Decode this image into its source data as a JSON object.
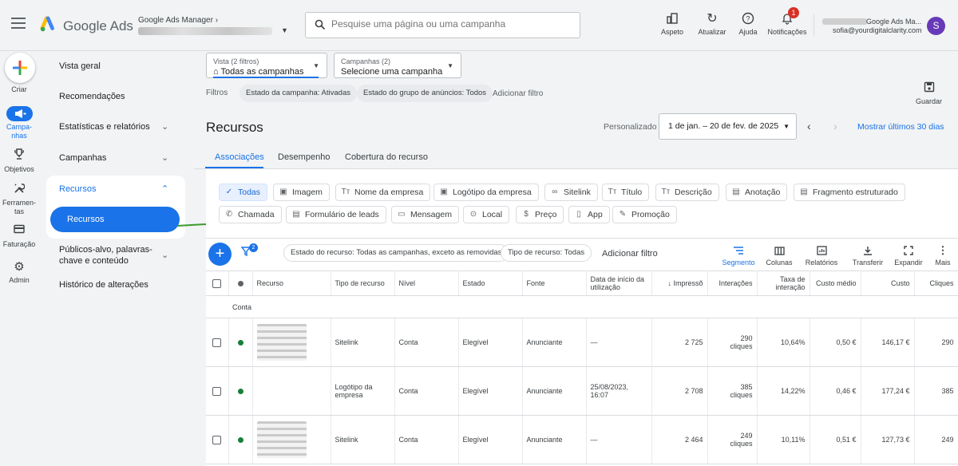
{
  "topbar": {
    "brand": "Google Ads",
    "manager_label": "Google Ads Manager",
    "search_placeholder": "Pesquise uma página ou uma campanha",
    "buttons": {
      "appearance": "Aspeto",
      "refresh": "Atualizar",
      "help": "Ajuda",
      "notifications": "Notificações"
    },
    "notification_count": "1",
    "account_name": "Google Ads Ma...",
    "account_email": "sofia@yourdigitalclarity.com",
    "avatar_letter": "S"
  },
  "rail": {
    "create": "Criar",
    "campaigns": "Campa-\nnhas",
    "goals": "Objetivos",
    "tools": "Ferramen-\ntas",
    "billing": "Faturação",
    "admin": "Admin"
  },
  "nav": {
    "overview": "Vista geral",
    "recommendations": "Recomendações",
    "stats": "Estatísticas e relatórios",
    "campaigns": "Campanhas",
    "assets_group": "Recursos",
    "assets_selected": "Recursos",
    "audiences": "Públicos-alvo, palavras-\nchave e conteúdo",
    "history": "Histórico de alterações"
  },
  "view_select": {
    "label": "Vista (2 filtros)",
    "value": "Todas as campanhas"
  },
  "campaign_select": {
    "label": "Campanhas (2)",
    "value": "Selecione uma campanha"
  },
  "filters": {
    "label": "Filtros",
    "chips": [
      "Estado da campanha: Ativadas",
      "Estado do grupo de anúncios: Todos"
    ],
    "add": "Adicionar filtro"
  },
  "save_label": "Guardar",
  "page_title": "Recursos",
  "date": {
    "label": "Personalizado",
    "range": "1 de jan. – 20 de fev. de 2025",
    "show_last": "Mostrar últimos 30 dias"
  },
  "tabs": [
    "Associações",
    "Desempenho",
    "Cobertura do recurso"
  ],
  "asset_types": {
    "row1": [
      {
        "label": "Todas",
        "icon": "check"
      },
      {
        "label": "Imagem",
        "icon": "image"
      },
      {
        "label": "Nome da empresa",
        "icon": "text"
      },
      {
        "label": "Logótipo da empresa",
        "icon": "image"
      },
      {
        "label": "Sitelink",
        "icon": "link"
      },
      {
        "label": "Título",
        "icon": "text"
      },
      {
        "label": "Descrição",
        "icon": "text"
      },
      {
        "label": "Anotação",
        "icon": "doc"
      },
      {
        "label": "Fragmento estruturado",
        "icon": "doc"
      }
    ],
    "row2": [
      {
        "label": "Chamada",
        "icon": "phone"
      },
      {
        "label": "Formulário de leads",
        "icon": "form"
      },
      {
        "label": "Mensagem",
        "icon": "message"
      },
      {
        "label": "Local",
        "icon": "pin"
      },
      {
        "label": "Preço",
        "icon": "price"
      },
      {
        "label": "App",
        "icon": "app"
      },
      {
        "label": "Promoção",
        "icon": "promo"
      }
    ]
  },
  "table_toolbar": {
    "filter_count": "2",
    "chips": [
      "Estado do recurso: Todas as campanhas, exceto as removidas",
      "Tipo de recurso: Todas"
    ],
    "add_filter": "Adicionar filtro",
    "tools": [
      "Segmento",
      "Colunas",
      "Relatórios",
      "Transferir",
      "Expandir",
      "Mais"
    ]
  },
  "table": {
    "headers": [
      "Recurso",
      "Tipo de recurso",
      "Nível",
      "Estado",
      "Fonte",
      "Data de início da utilização",
      "Impressõ",
      "Interações",
      "Taxa de interação",
      "Custo médio",
      "Custo",
      "Cliques"
    ],
    "section": "Conta",
    "rows": [
      {
        "type": "Sitelink",
        "level": "Conta",
        "status": "Elegível",
        "source": "Anunciante",
        "start": "—",
        "impr": "2 725",
        "inter": "290\ncliques",
        "rate": "10,64%",
        "avg": "0,50 €",
        "cost": "146,17 €",
        "clicks": "290"
      },
      {
        "type": "Logótipo da\nempresa",
        "level": "Conta",
        "status": "Elegível",
        "source": "Anunciante",
        "start": "25/08/2023,\n16:07",
        "impr": "2 708",
        "inter": "385\ncliques",
        "rate": "14,22%",
        "avg": "0,46 €",
        "cost": "177,24 €",
        "clicks": "385"
      },
      {
        "type": "Sitelink",
        "level": "Conta",
        "status": "Elegível",
        "source": "Anunciante",
        "start": "—",
        "impr": "2 464",
        "inter": "249\ncliques",
        "rate": "10,11%",
        "avg": "0,51 €",
        "cost": "127,73 €",
        "clicks": "249"
      }
    ]
  },
  "colors": {
    "accent": "#1a73e8",
    "status_ok": "#188038",
    "notif": "#d93025",
    "avatar": "#673ab7"
  }
}
